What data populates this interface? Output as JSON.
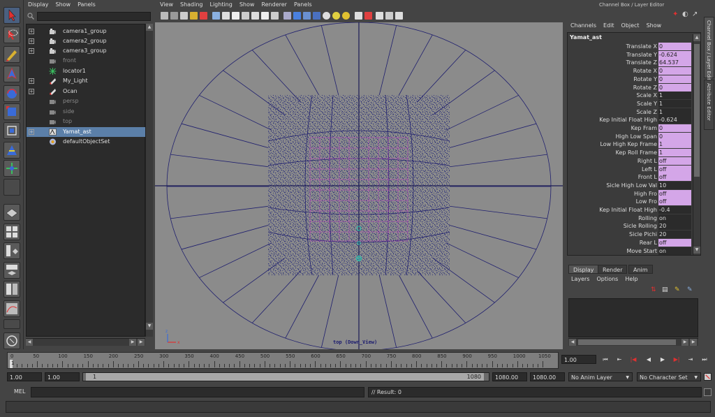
{
  "outliner": {
    "menu": [
      "Display",
      "Show",
      "Panels"
    ],
    "items": [
      {
        "label": "camera1_group",
        "icon": "camera-group-icon",
        "expandable": true,
        "dim": false,
        "selected": false
      },
      {
        "label": "camera2_group",
        "icon": "camera-group-icon",
        "expandable": true,
        "dim": false,
        "selected": false
      },
      {
        "label": "camera3_group",
        "icon": "camera-group-icon",
        "expandable": true,
        "dim": false,
        "selected": false
      },
      {
        "label": "front",
        "icon": "camera-icon",
        "expandable": false,
        "dim": true,
        "selected": false
      },
      {
        "label": "locator1",
        "icon": "locator-icon",
        "expandable": false,
        "dim": false,
        "selected": false
      },
      {
        "label": "My_Light",
        "icon": "light-icon",
        "expandable": true,
        "dim": false,
        "selected": false
      },
      {
        "label": "Ocan",
        "icon": "mesh-icon",
        "expandable": true,
        "dim": false,
        "selected": false
      },
      {
        "label": "persp",
        "icon": "camera-icon",
        "expandable": false,
        "dim": true,
        "selected": false
      },
      {
        "label": "side",
        "icon": "camera-icon",
        "expandable": false,
        "dim": true,
        "selected": false
      },
      {
        "label": "top",
        "icon": "camera-icon",
        "expandable": false,
        "dim": true,
        "selected": false
      },
      {
        "label": "Yamat_ast",
        "icon": "transform-icon",
        "expandable": true,
        "dim": false,
        "selected": true
      },
      {
        "label": "defaultObjectSet",
        "icon": "set-icon",
        "expandable": false,
        "dim": false,
        "selected": false
      }
    ]
  },
  "viewport": {
    "menu": [
      "View",
      "Shading",
      "Lighting",
      "Show",
      "Renderer",
      "Panels"
    ],
    "label": "top (Down_View)"
  },
  "channelbox": {
    "header": "Channel Box / Layer Editor",
    "menu": [
      "Channels",
      "Edit",
      "Object",
      "Show"
    ],
    "node": "Yamat_ast",
    "attributes": [
      {
        "name": "Translate X",
        "value": "0",
        "keyed": true
      },
      {
        "name": "Translate Y",
        "value": "-0.624",
        "keyed": true
      },
      {
        "name": "Translate Z",
        "value": "64.537",
        "keyed": true
      },
      {
        "name": "Rotate X",
        "value": "0",
        "keyed": true
      },
      {
        "name": "Rotate Y",
        "value": "0",
        "keyed": true
      },
      {
        "name": "Rotate Z",
        "value": "0",
        "keyed": true
      },
      {
        "name": "Scale X",
        "value": "1",
        "keyed": false
      },
      {
        "name": "Scale Y",
        "value": "1",
        "keyed": false
      },
      {
        "name": "Scale Z",
        "value": "1",
        "keyed": false
      },
      {
        "name": "Kep Initial Float High",
        "value": "-0.624",
        "keyed": false
      },
      {
        "name": "Kep Fram",
        "value": "0",
        "keyed": true
      },
      {
        "name": "High Low Span",
        "value": "0",
        "keyed": true
      },
      {
        "name": "Low High Kep Frame",
        "value": "1",
        "keyed": true
      },
      {
        "name": "Kep Roll Frame",
        "value": "1",
        "keyed": true
      },
      {
        "name": "Right L",
        "value": "off",
        "keyed": true
      },
      {
        "name": "Left L",
        "value": "off",
        "keyed": true
      },
      {
        "name": "Front L",
        "value": "off",
        "keyed": true
      },
      {
        "name": "Sicle High Low Val",
        "value": "10",
        "keyed": false
      },
      {
        "name": "High Fro",
        "value": "off",
        "keyed": true
      },
      {
        "name": "Low Fro",
        "value": "off",
        "keyed": true
      },
      {
        "name": "Kep Initial Float High",
        "value": "-0.4",
        "keyed": false
      },
      {
        "name": "Rolling",
        "value": "on",
        "keyed": false
      },
      {
        "name": "Sicle Rolling",
        "value": "20",
        "keyed": false
      },
      {
        "name": "Sicle Pichi",
        "value": "20",
        "keyed": false
      },
      {
        "name": "Rear L",
        "value": "off",
        "keyed": true
      },
      {
        "name": "Move Start",
        "value": "on",
        "keyed": false
      }
    ],
    "side_tabs": [
      "Channel Box / Layer Editor",
      "Attribute Editor"
    ]
  },
  "layer_editor": {
    "tabs": [
      "Display",
      "Render",
      "Anim"
    ],
    "menu": [
      "Layers",
      "Options",
      "Help"
    ]
  },
  "timeline": {
    "ticks": [
      0,
      50,
      100,
      150,
      200,
      250,
      300,
      350,
      400,
      450,
      500,
      550,
      600,
      650,
      700,
      750,
      800,
      850,
      900,
      950,
      1000,
      1050
    ],
    "current_frame": "1.00",
    "current_display": "1",
    "playback_buttons": [
      "go-to-start",
      "step-back-key",
      "step-back",
      "play-back",
      "play-forward",
      "step-forward",
      "step-forward-key",
      "go-to-end"
    ]
  },
  "range": {
    "start_time": "1.00",
    "playback_start": "1.00",
    "range_start_label": "1",
    "range_end_label": "1080",
    "playback_end": "1080.00",
    "end_time": "1080.00",
    "anim_layer": "No Anim Layer",
    "character_set": "No Character Set"
  },
  "command": {
    "lang": "MEL",
    "result": "// Result: 0"
  },
  "colors": {
    "viewport_bg": "#8b8b8b",
    "wire": "#1e1e6e",
    "selected_wire": "#c040c0",
    "keyed": "#d4a6e8",
    "selection": "#5b7fa8"
  }
}
